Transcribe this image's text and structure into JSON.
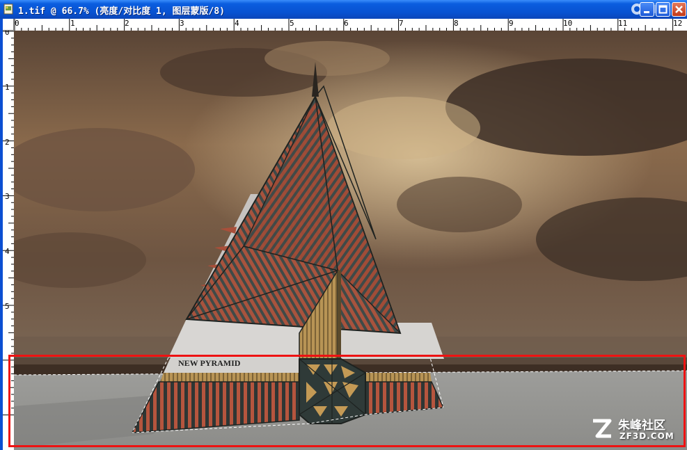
{
  "window": {
    "title": "1.tif @ 66.7% (亮度/对比度 1, 图层蒙版/8)",
    "title_icon": "tif-document-icon",
    "controls": [
      "minimize-icon",
      "maximize-icon",
      "close-icon"
    ],
    "logo_icon": "site-logo-icon"
  },
  "ruler_horizontal": {
    "labels": [
      "0",
      "1",
      "2",
      "3",
      "4",
      "5",
      "6",
      "7",
      "8",
      "9",
      "10",
      "11",
      "12"
    ]
  },
  "ruler_vertical": {
    "labels": [
      "0",
      "1",
      "2",
      "3",
      "4",
      "5"
    ]
  },
  "image": {
    "description_icon": "pyramid-building-render",
    "sign_text": "NEW PYRAMID"
  },
  "watermark": {
    "name": "朱峰社区",
    "domain": "ZF3D.COM"
  },
  "colors": {
    "selection": "#ee1212",
    "titlebar": "#0851d0",
    "sky": "#8a6a4c",
    "ground": "#9b9b98"
  }
}
